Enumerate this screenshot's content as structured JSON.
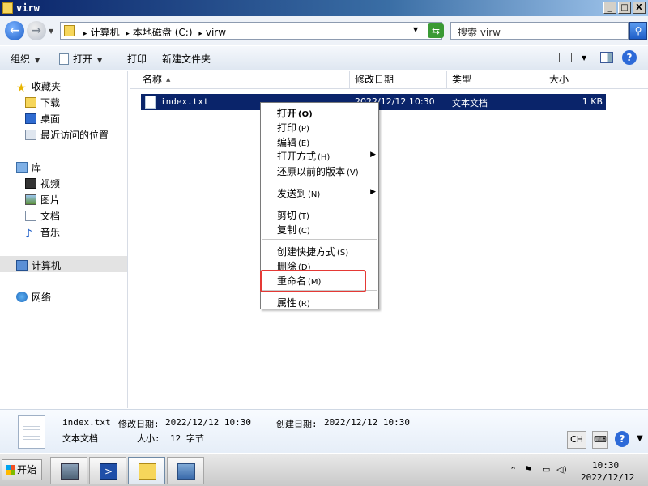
{
  "window": {
    "title": "virw"
  },
  "caption_buttons": {
    "minimize": "_",
    "maximize": "□",
    "close": "X"
  },
  "address": {
    "crumbs": [
      "计算机",
      "本地磁盘 (C:)",
      "virw"
    ]
  },
  "search": {
    "placeholder": "搜索 virw"
  },
  "toolbar": {
    "organize": "组织",
    "open": "打开",
    "print": "打印",
    "new_folder": "新建文件夹"
  },
  "sidebar": {
    "favorites": "收藏夹",
    "downloads": "下载",
    "desktop": "桌面",
    "recent": "最近访问的位置",
    "libraries": "库",
    "videos": "视频",
    "pictures": "图片",
    "documents": "文档",
    "music": "音乐",
    "computer": "计算机",
    "network": "网络"
  },
  "columns": {
    "name": "名称",
    "modified": "修改日期",
    "type": "类型",
    "size": "大小"
  },
  "file": {
    "name": "index.txt",
    "modified": "2022/12/12 10:30",
    "type": "文本文档",
    "size": "1 KB"
  },
  "context_menu": {
    "open": "打开",
    "open_key": "(O)",
    "print": "打印",
    "print_key": "(P)",
    "edit": "编辑",
    "edit_key": "(E)",
    "open_with": "打开方式",
    "open_with_key": "(H)",
    "restore": "还原以前的版本",
    "restore_key": "(V)",
    "send_to": "发送到",
    "send_to_key": "(N)",
    "cut": "剪切",
    "cut_key": "(T)",
    "copy": "复制",
    "copy_key": "(C)",
    "shortcut": "创建快捷方式",
    "shortcut_key": "(S)",
    "delete": "删除",
    "delete_key": "(D)",
    "rename": "重命名",
    "rename_key": "(M)",
    "properties": "属性",
    "properties_key": "(R)"
  },
  "details": {
    "name": "index.txt",
    "modified_label": "修改日期:",
    "modified": "2022/12/12 10:30",
    "created_label": "创建日期:",
    "created": "2022/12/12 10:30",
    "type": "文本文档",
    "size_label": "大小:",
    "size": "12 字节"
  },
  "lang": "CH",
  "taskbar": {
    "start": "开始",
    "time": "10:30",
    "date": "2022/12/12"
  },
  "colors": {
    "selection": "#0a246a",
    "highlight_box": "#e53935"
  }
}
